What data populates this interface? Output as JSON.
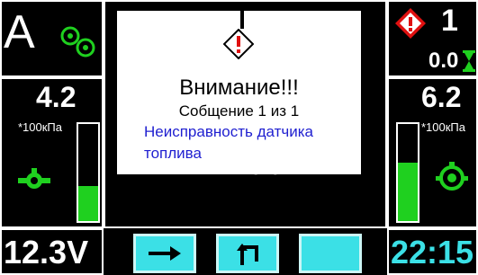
{
  "mode": {
    "letter": "A"
  },
  "left_gauge": {
    "value": "4.2",
    "unit": "*100кПа",
    "level": 0.36
  },
  "right_gauge": {
    "value": "6.2",
    "unit": "*100кПа",
    "level": 0.6
  },
  "alerts": {
    "count": "1",
    "timer": "0.0"
  },
  "battery": {
    "value": "12.3V"
  },
  "clock": {
    "value": "22:15"
  },
  "dialog": {
    "title": "Внимание!!!",
    "subtitle": "Собщение 1 из 1",
    "message": "Неисправность датчика топлива"
  },
  "colors": {
    "accent_green": "#1fd01f",
    "accent_cyan": "#3be0e6",
    "message_blue": "#1f1fd0",
    "warning_red": "#e01010"
  },
  "icons": [
    "gears-icon",
    "engine-pump-icon",
    "warning-diamond-icon",
    "hourglass-icon",
    "turbo-icon",
    "arrow-right-icon",
    "return-icon"
  ]
}
